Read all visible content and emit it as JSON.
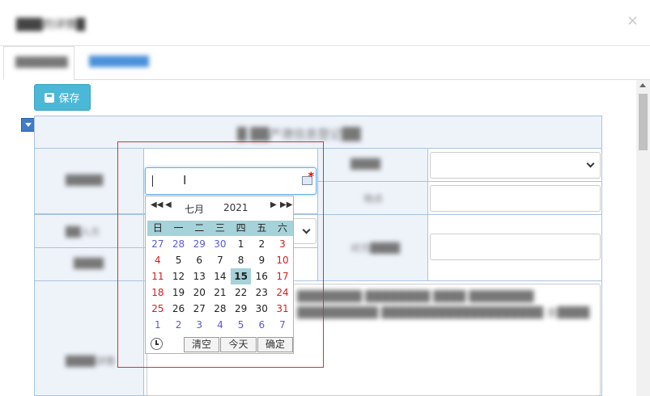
{
  "header": {
    "title": "███的详情█",
    "close_label": "×"
  },
  "tabs": [
    {
      "label": "███████"
    },
    {
      "label": "████████"
    }
  ],
  "toolbar": {
    "save_label": "保存",
    "save_icon": "floppy-disk-icon"
  },
  "form": {
    "title": "█ ██产港信息登记██",
    "labels": {
      "row1_left": "█████",
      "row1_right": "████",
      "row2_right": "地点",
      "row3_left": "██入方",
      "row3_right": "对方████",
      "row4_left": "████",
      "row5_left": "████详情"
    },
    "detail_text": "████████ ████████ ████ ████████ ██████████ ████████████████████ 金████",
    "row3_select_chevron": "chevron-down-icon"
  },
  "date_input": {
    "value": ""
  },
  "calendar": {
    "month": "七月",
    "year": "2021",
    "weekdays": [
      "日",
      "一",
      "二",
      "三",
      "四",
      "五",
      "六"
    ],
    "weeks": [
      [
        "27",
        "28",
        "29",
        "30",
        "1",
        "2",
        "3"
      ],
      [
        "4",
        "5",
        "6",
        "7",
        "8",
        "9",
        "10"
      ],
      [
        "11",
        "12",
        "13",
        "14",
        "15",
        "16",
        "17"
      ],
      [
        "18",
        "19",
        "20",
        "21",
        "22",
        "23",
        "24"
      ],
      [
        "25",
        "26",
        "27",
        "28",
        "29",
        "30",
        "31"
      ],
      [
        "1",
        "2",
        "3",
        "4",
        "5",
        "6",
        "7"
      ]
    ],
    "today": "15",
    "buttons": {
      "clear": "清空",
      "today": "今天",
      "ok": "确定"
    },
    "colors": {
      "header_bg": "#a6d2da",
      "weekend": "#d02020",
      "other_month": "#5a5ad0"
    }
  }
}
